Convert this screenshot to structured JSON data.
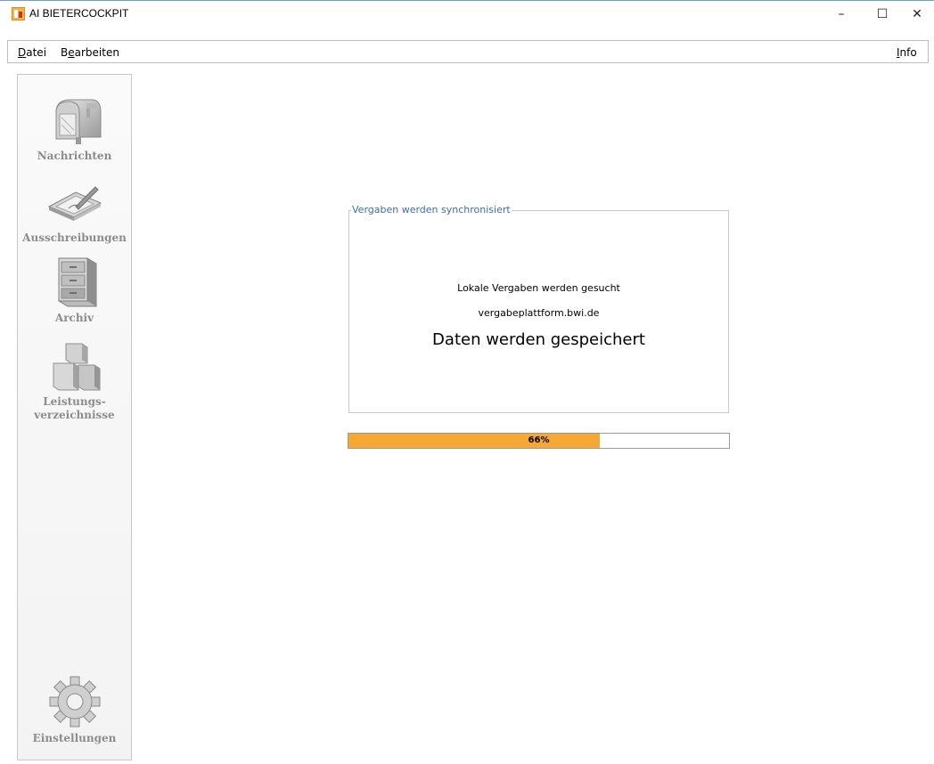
{
  "window": {
    "title": "AI BIETERCOCKPIT",
    "controls": {
      "minimize": "–",
      "maximize": "☐",
      "close": "✕"
    }
  },
  "menu": {
    "datei_mnemonic": "D",
    "datei_rest": "atei",
    "bearbeiten_first": "B",
    "bearbeiten_mnemonic": "e",
    "bearbeiten_rest": "arbeiten",
    "info_mnemonic": "I",
    "info_rest": "nfo"
  },
  "sidebar": {
    "items": [
      {
        "label": "Nachrichten",
        "icon": "mailbox-icon"
      },
      {
        "label": "Ausschreibungen",
        "icon": "signing-pad-icon"
      },
      {
        "label": "Archiv",
        "icon": "filing-cabinet-icon"
      },
      {
        "label_line1": "Leistungs-",
        "label_line2": "verzeichnisse",
        "icon": "boxes-icon"
      },
      {
        "label": "Einstellungen",
        "icon": "gear-icon"
      }
    ]
  },
  "sync": {
    "group_title": "Vergaben werden synchronisiert",
    "line1": "Lokale Vergaben werden gesucht",
    "line2": "vergabeplattform.bwi.de",
    "line3": "Daten werden gespeichert"
  },
  "progress": {
    "value": 0.66,
    "label": "66%",
    "fill_color": "#f7a833"
  },
  "colors": {
    "accent_title": "#3b6db5",
    "window_border": "#6aa0d8"
  }
}
